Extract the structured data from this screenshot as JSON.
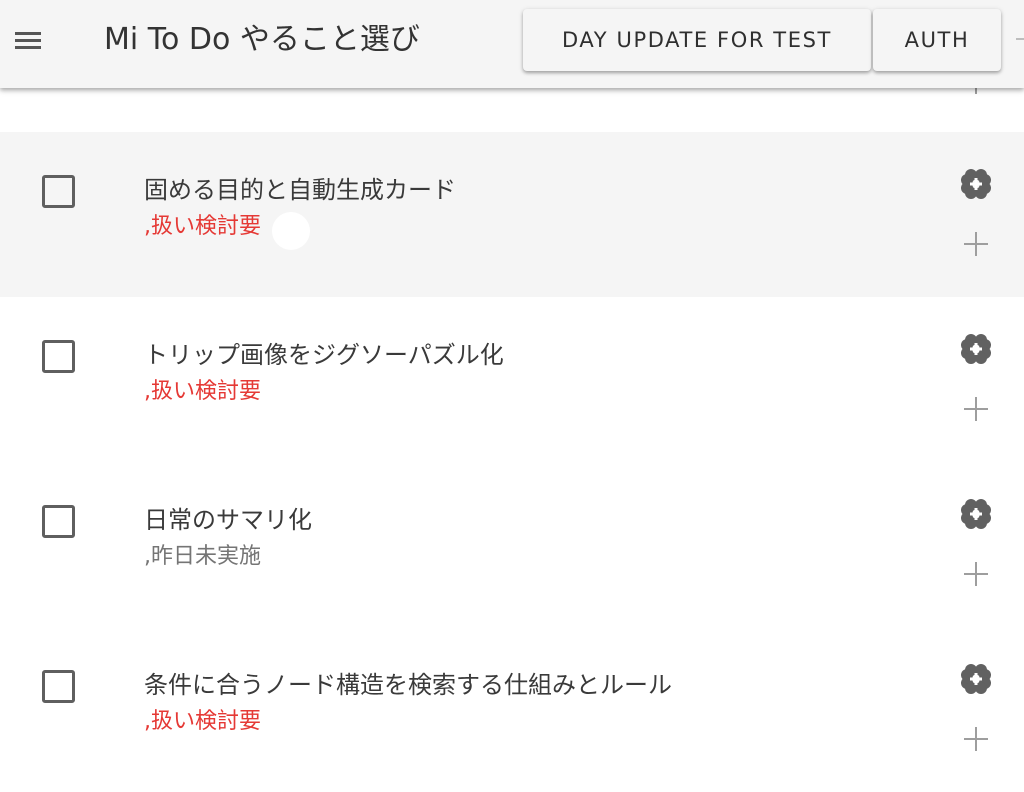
{
  "app_bar": {
    "title": "Mi To Do やること選び",
    "day_update_label": "DAY UPDATE FOR TEST",
    "auth_label": "AUTH",
    "menu_icon": "hamburger-menu-icon"
  },
  "colors": {
    "app_bar_bg": "#f5f5f5",
    "active_row_bg": "#f5f5f5",
    "warning_text": "#e53935",
    "muted_text": "#757575",
    "icon_color": "#616161",
    "plus_color": "#9e9e9e"
  },
  "todos": [
    {
      "title": "固める目的と自動生成カード",
      "status": ",扱い検討要",
      "status_type": "warning",
      "checked": false
    },
    {
      "title": "トリップ画像をジグソーパズル化",
      "status": ",扱い検討要",
      "status_type": "warning",
      "checked": false
    },
    {
      "title": "日常のサマリ化",
      "status": ",昨日未実施",
      "status_type": "muted",
      "checked": false
    },
    {
      "title": "条件に合うノード構造を検索する仕組みとルール",
      "status": ",扱い検討要",
      "status_type": "warning",
      "checked": false
    }
  ],
  "row_icons": {
    "primary": "clover-icon",
    "secondary": "plus-icon"
  }
}
